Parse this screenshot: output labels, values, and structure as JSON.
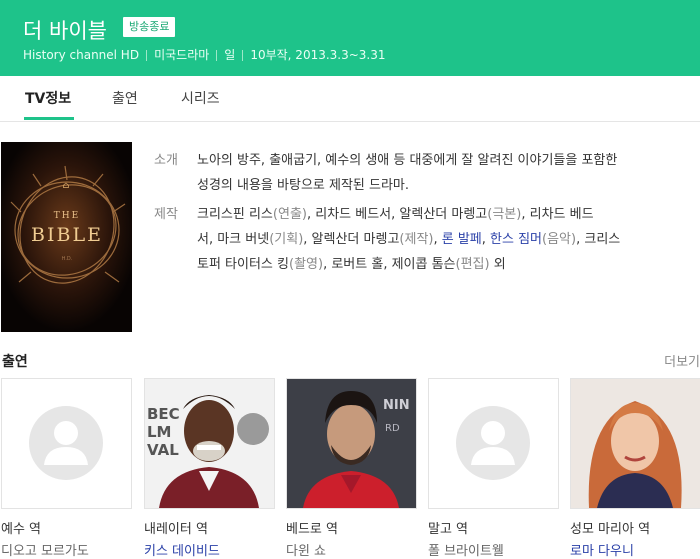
{
  "header": {
    "title": "더 바이블",
    "badge": "방송종료",
    "meta": [
      "History channel HD",
      "미국드라마",
      "일",
      "10부작, 2013.3.3~3.31"
    ]
  },
  "tabs": [
    "TV정보",
    "출연",
    "시리즈"
  ],
  "poster": {
    "text": "THE BIBLE"
  },
  "info": {
    "intro_label": "소개",
    "intro": [
      "노아의 방주, 출애굽기, 예수의 생애 등 대중에게 잘 알려진 이야기들을 포함한",
      "성경의 내용을 바탕으로 제작된 드라마."
    ],
    "prod_label": "제작",
    "prod": [
      [
        [
          "크리스핀 리스",
          "n"
        ],
        [
          "(연출)",
          "s"
        ],
        [
          ", 리차드 베드서, 알렉산더 마렝고",
          "n"
        ],
        [
          "(극본)",
          "s"
        ],
        [
          ", 리차드 베드",
          "n"
        ]
      ],
      [
        [
          "서, 마크 버넷",
          "n"
        ],
        [
          "(기획)",
          "s"
        ],
        [
          ", 알렉산더 마렝고",
          "n"
        ],
        [
          "(제작)",
          "s"
        ],
        [
          ", ",
          "n"
        ],
        [
          "론 발페",
          "l"
        ],
        [
          ", ",
          "n"
        ],
        [
          "한스 짐머",
          "l"
        ],
        [
          "(음악)",
          "s"
        ],
        [
          ", 크리스",
          "n"
        ]
      ],
      [
        [
          "토퍼 타이터스 킹",
          "n"
        ],
        [
          "(촬영)",
          "s"
        ],
        [
          ", 로버트 홀, 제이콥 톰슨",
          "n"
        ],
        [
          "(편집)",
          "s"
        ],
        [
          " 외",
          "n"
        ]
      ]
    ]
  },
  "cast": {
    "title": "출연",
    "more": "더보기",
    "items": [
      {
        "role": "예수 역",
        "actor": "디오고 모르가도",
        "link": false,
        "photo": "placeholder"
      },
      {
        "role": "내레이터 역",
        "actor": "키스 데이비드",
        "link": true,
        "photo": "keith"
      },
      {
        "role": "베드로 역",
        "actor": "다윈 쇼",
        "link": false,
        "photo": "darwin"
      },
      {
        "role": "말고 역",
        "actor": "폴 브라이트웰",
        "link": false,
        "photo": "placeholder"
      },
      {
        "role": "성모 마리아 역",
        "actor": "로마 다우니",
        "link": true,
        "photo": "roma"
      }
    ]
  }
}
